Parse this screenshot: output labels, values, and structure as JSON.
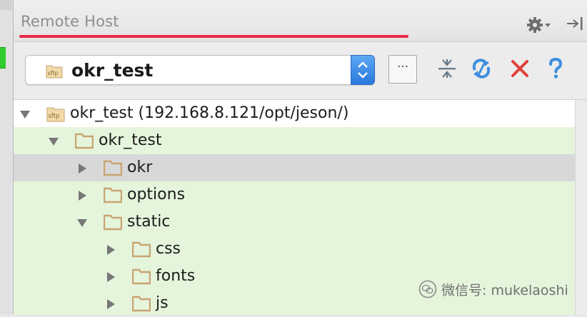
{
  "panel": {
    "title": "Remote Host"
  },
  "toolbar": {
    "server_select": {
      "value": "okr_test"
    },
    "ellipsis_label": "···"
  },
  "tree": {
    "root": {
      "label": "okr_test (192.168.8.121/opt/jeson/)"
    },
    "rows": [
      {
        "label": "okr_test",
        "expanded": true
      },
      {
        "label": "okr",
        "expanded": false,
        "selected": true
      },
      {
        "label": "options",
        "expanded": false
      },
      {
        "label": "static",
        "expanded": true
      },
      {
        "label": "css",
        "expanded": false
      },
      {
        "label": "fonts",
        "expanded": false
      },
      {
        "label": "js",
        "expanded": false
      }
    ]
  },
  "watermark": {
    "text": "微信号: mukelaoshi"
  },
  "icons": {
    "gear": "gear-icon",
    "hide": "hide-panel-icon",
    "collapse": "collapse-all-icon",
    "sync": "sync-icon",
    "close": "close-icon",
    "help": "help-icon",
    "sftp": "sftp-icon",
    "folder": "folder-icon"
  },
  "colors": {
    "accent_underline": "#ee2a4a",
    "tree_background": "#e5f5dc",
    "selected_row": "#d8d8d8",
    "select_arrow": "#3a8ae6",
    "close_red": "#e0403a",
    "help_blue": "#3d8ee0",
    "folder_tan": "#c9a473",
    "status_green": "#2ecc2e"
  }
}
